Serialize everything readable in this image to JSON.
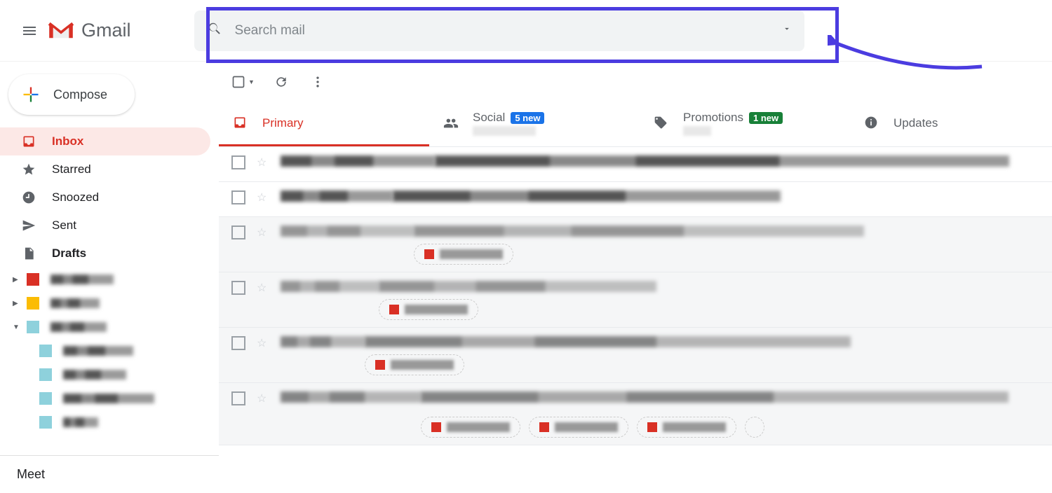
{
  "header": {
    "brand": "Gmail",
    "search_placeholder": "Search mail"
  },
  "sidebar": {
    "compose_label": "Compose",
    "nav": [
      {
        "label": "Inbox",
        "icon": "inbox"
      },
      {
        "label": "Starred",
        "icon": "star"
      },
      {
        "label": "Snoozed",
        "icon": "clock"
      },
      {
        "label": "Sent",
        "icon": "send"
      },
      {
        "label": "Drafts",
        "icon": "file"
      }
    ],
    "meet_label": "Meet"
  },
  "tabs": {
    "primary": "Primary",
    "social": "Social",
    "social_badge": "5 new",
    "promotions": "Promotions",
    "promotions_badge": "1 new",
    "updates": "Updates"
  }
}
